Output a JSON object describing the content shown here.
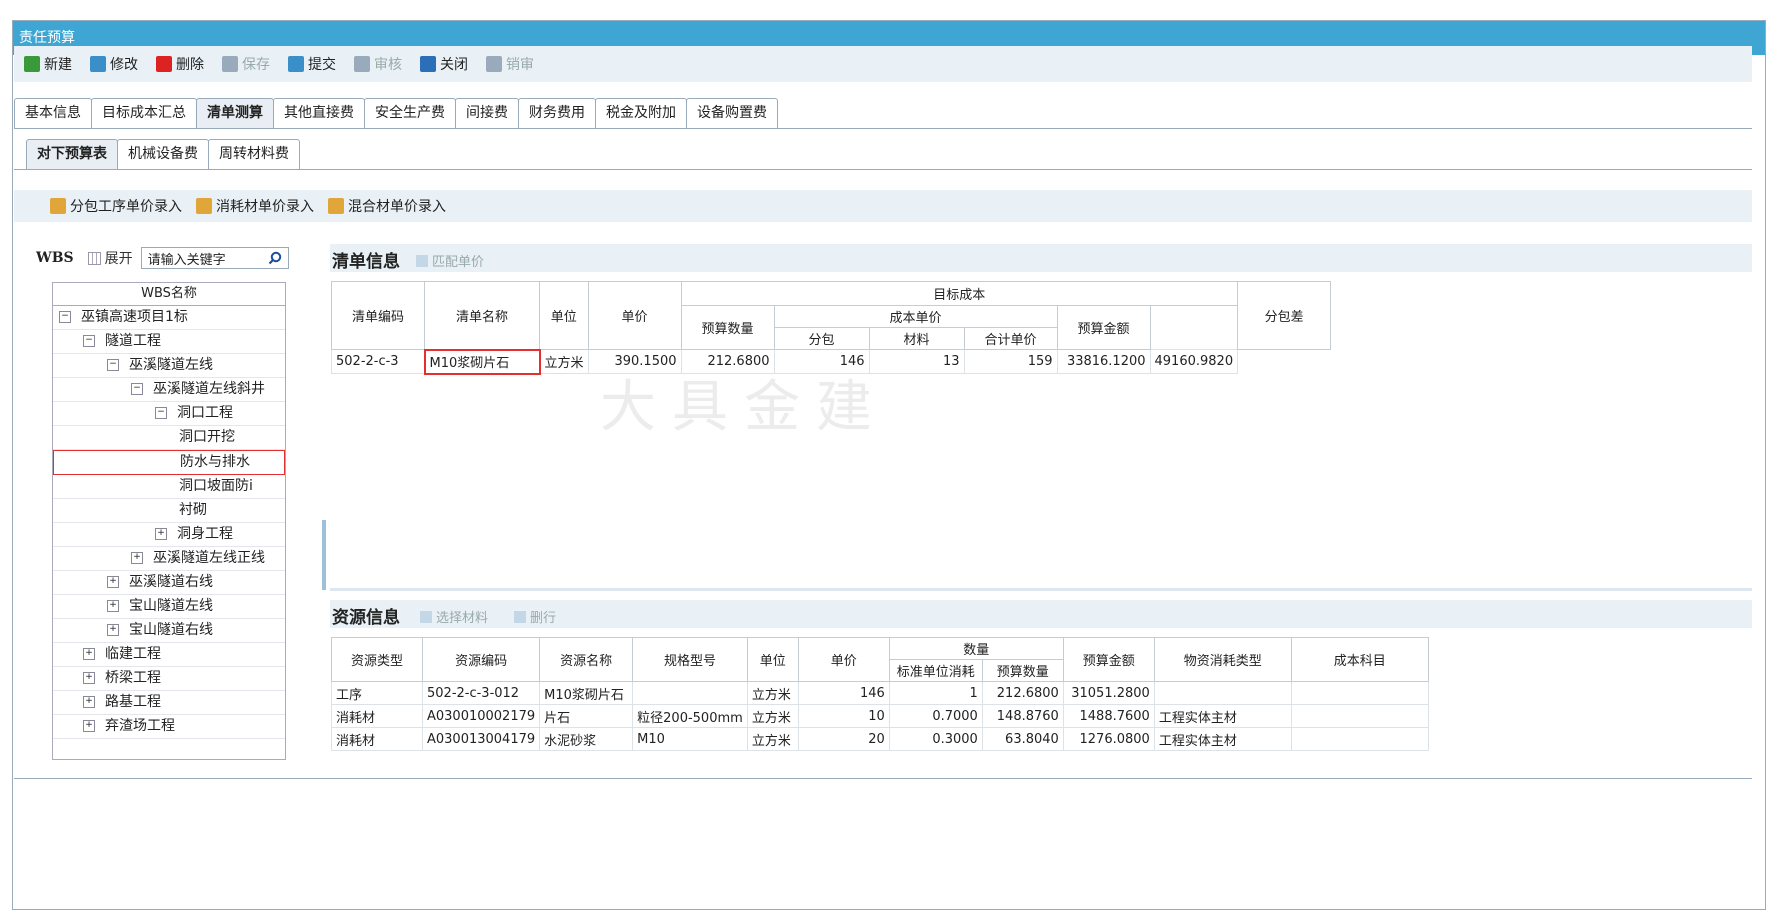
{
  "window": {
    "title": "责任预算"
  },
  "toolbar": [
    {
      "label": "新建",
      "color": "#3a9a3a",
      "enabled": true
    },
    {
      "label": "修改",
      "color": "#3a8fc8",
      "enabled": true
    },
    {
      "label": "删除",
      "color": "#d22",
      "enabled": true
    },
    {
      "label": "保存",
      "color": "#9ab",
      "enabled": false
    },
    {
      "label": "提交",
      "color": "#3a8fc8",
      "enabled": true
    },
    {
      "label": "审核",
      "color": "#9ab",
      "enabled": false
    },
    {
      "label": "关闭",
      "color": "#2a6fb8",
      "enabled": true
    },
    {
      "label": "销审",
      "color": "#9ab",
      "enabled": false
    }
  ],
  "tabs_main": [
    "基本信息",
    "目标成本汇总",
    "清单测算",
    "其他直接费",
    "安全生产费",
    "间接费",
    "财务费用",
    "税金及附加",
    "设备购置费"
  ],
  "tabs_main_active": 2,
  "tabs_sub": [
    "对下预算表",
    "机械设备费",
    "周转材料费"
  ],
  "tabs_sub_active": 0,
  "sub_toolbar": [
    "分包工序单价录入",
    "消耗材单价录入",
    "混合材单价录入"
  ],
  "wbs": {
    "label": "WBS",
    "expand_label": "展开",
    "search_placeholder": "请输入关键字",
    "column_header": "WBS名称",
    "nodes": [
      {
        "label": "巫镇高速项目1标",
        "indent": 0,
        "toggle": "−"
      },
      {
        "label": "隧道工程",
        "indent": 1,
        "toggle": "−"
      },
      {
        "label": "巫溪隧道左线",
        "indent": 2,
        "toggle": "−"
      },
      {
        "label": "巫溪隧道左线斜井",
        "indent": 3,
        "toggle": "−"
      },
      {
        "label": "洞口工程",
        "indent": 4,
        "toggle": "−"
      },
      {
        "label": "洞口开挖",
        "indent": 5,
        "toggle": ""
      },
      {
        "label": "防水与排水",
        "indent": 5,
        "toggle": "",
        "selected": true
      },
      {
        "label": "洞口坡面防i",
        "indent": 5,
        "toggle": ""
      },
      {
        "label": "衬砌",
        "indent": 5,
        "toggle": ""
      },
      {
        "label": "洞身工程",
        "indent": 4,
        "toggle": "+"
      },
      {
        "label": "巫溪隧道左线正线",
        "indent": 3,
        "toggle": "+"
      },
      {
        "label": "巫溪隧道右线",
        "indent": 2,
        "toggle": "+"
      },
      {
        "label": "宝山隧道左线",
        "indent": 2,
        "toggle": "+"
      },
      {
        "label": "宝山隧道右线",
        "indent": 2,
        "toggle": "+"
      },
      {
        "label": "临建工程",
        "indent": 1,
        "toggle": "+"
      },
      {
        "label": "桥梁工程",
        "indent": 1,
        "toggle": "+"
      },
      {
        "label": "路基工程",
        "indent": 1,
        "toggle": "+"
      },
      {
        "label": "弃渣场工程",
        "indent": 1,
        "toggle": "+"
      }
    ]
  },
  "bill": {
    "title": "清单信息",
    "action": "匹配单价",
    "headers": {
      "code": "清单编码",
      "name": "清单名称",
      "unit": "单位",
      "price": "单价",
      "target_cost": "目标成本",
      "budget_qty": "预算数量",
      "cost_unit_price": "成本单价",
      "subcontract": "分包",
      "material": "材料",
      "total_unit_price": "合计单价",
      "budget_amount": "预算金额",
      "diff": "分包差"
    },
    "rows": [
      {
        "code": "502-2-c-3",
        "name": "M10浆砌片石",
        "unit": "立方米",
        "price": "390.1500",
        "qty": "212.6800",
        "subcontract": "146",
        "material": "13",
        "total": "159",
        "amount": "33816.1200",
        "diff": "49160.9820"
      }
    ]
  },
  "watermark": "大具金建",
  "resource": {
    "title": "资源信息",
    "actions": [
      "选择材料",
      "删行"
    ],
    "headers": {
      "type": "资源类型",
      "code": "资源编码",
      "name": "资源名称",
      "spec": "规格型号",
      "unit": "单位",
      "price": "单价",
      "quantity": "数量",
      "std_consume": "标准单位消耗",
      "budget_qty": "预算数量",
      "amount": "预算金额",
      "consume_type": "物资消耗类型",
      "cost_subject": "成本科目"
    },
    "rows": [
      {
        "type": "工序",
        "code": "502-2-c-3-012",
        "name": "M10浆砌片石",
        "spec": "",
        "unit": "立方米",
        "price": "146",
        "std": "1",
        "qty": "212.6800",
        "amount": "31051.2800",
        "consume_type": "",
        "subject": ""
      },
      {
        "type": "消耗材",
        "code": "A030010002179",
        "name": "片石",
        "spec": "粒径200-500mm",
        "unit": "立方米",
        "price": "10",
        "std": "0.7000",
        "qty": "148.8760",
        "amount": "1488.7600",
        "consume_type": "工程实体主材",
        "subject": ""
      },
      {
        "type": "消耗材",
        "code": "A030013004179",
        "name": "水泥砂浆",
        "spec": "M10",
        "unit": "立方米",
        "price": "20",
        "std": "0.3000",
        "qty": "63.8040",
        "amount": "1276.0800",
        "consume_type": "工程实体主材",
        "subject": ""
      }
    ]
  }
}
